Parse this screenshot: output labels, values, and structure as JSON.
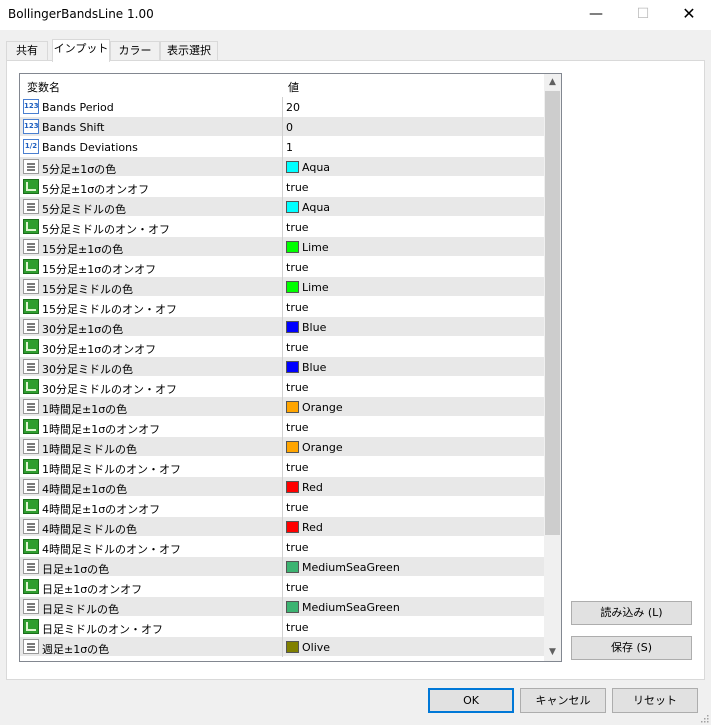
{
  "window": {
    "title": "BollingerBandsLine 1.00"
  },
  "window_controls": {
    "minimize": "—",
    "maximize": "☐",
    "close": "✕"
  },
  "tabs": [
    {
      "label": "共有",
      "active": false
    },
    {
      "label": "インプット",
      "active": true
    },
    {
      "label": "カラー",
      "active": false
    },
    {
      "label": "表示選択",
      "active": false
    }
  ],
  "grid": {
    "header": {
      "name": "変数名",
      "value": "値"
    },
    "rows": [
      {
        "icon": "number-icon",
        "icon_text": "123",
        "name": "Bands Period",
        "value": "20"
      },
      {
        "icon": "number-icon",
        "icon_text": "123",
        "name": "Bands Shift",
        "value": "0"
      },
      {
        "icon": "fraction-icon",
        "icon_text": "1/2",
        "name": "Bands Deviations",
        "value": "1"
      },
      {
        "icon": "color-icon",
        "name": "5分足±1σの色",
        "value": "Aqua",
        "swatch": "#00ffff"
      },
      {
        "icon": "bool-icon",
        "name": "5分足±1σのオンオフ",
        "value": "true"
      },
      {
        "icon": "color-icon",
        "name": "5分足ミドルの色",
        "value": "Aqua",
        "swatch": "#00ffff"
      },
      {
        "icon": "bool-icon",
        "name": "5分足ミドルのオン・オフ",
        "value": "true"
      },
      {
        "icon": "color-icon",
        "name": "15分足±1σの色",
        "value": "Lime",
        "swatch": "#00ff00"
      },
      {
        "icon": "bool-icon",
        "name": "15分足±1σのオンオフ",
        "value": "true"
      },
      {
        "icon": "color-icon",
        "name": "15分足ミドルの色",
        "value": "Lime",
        "swatch": "#00ff00"
      },
      {
        "icon": "bool-icon",
        "name": "15分足ミドルのオン・オフ",
        "value": "true"
      },
      {
        "icon": "color-icon",
        "name": "30分足±1σの色",
        "value": "Blue",
        "swatch": "#0000ff"
      },
      {
        "icon": "bool-icon",
        "name": "30分足±1σのオンオフ",
        "value": "true"
      },
      {
        "icon": "color-icon",
        "name": "30分足ミドルの色",
        "value": "Blue",
        "swatch": "#0000ff"
      },
      {
        "icon": "bool-icon",
        "name": "30分足ミドルのオン・オフ",
        "value": "true"
      },
      {
        "icon": "color-icon",
        "name": "1時間足±1σの色",
        "value": "Orange",
        "swatch": "#ffa500"
      },
      {
        "icon": "bool-icon",
        "name": "1時間足±1σのオンオフ",
        "value": "true"
      },
      {
        "icon": "color-icon",
        "name": "1時間足ミドルの色",
        "value": "Orange",
        "swatch": "#ffa500"
      },
      {
        "icon": "bool-icon",
        "name": "1時間足ミドルのオン・オフ",
        "value": "true"
      },
      {
        "icon": "color-icon",
        "name": "4時間足±1σの色",
        "value": "Red",
        "swatch": "#ff0000"
      },
      {
        "icon": "bool-icon",
        "name": "4時間足±1σのオンオフ",
        "value": "true"
      },
      {
        "icon": "color-icon",
        "name": "4時間足ミドルの色",
        "value": "Red",
        "swatch": "#ff0000"
      },
      {
        "icon": "bool-icon",
        "name": "4時間足ミドルのオン・オフ",
        "value": "true"
      },
      {
        "icon": "color-icon",
        "name": "日足±1σの色",
        "value": "MediumSeaGreen",
        "swatch": "#3cb371"
      },
      {
        "icon": "bool-icon",
        "name": "日足±1σのオンオフ",
        "value": "true"
      },
      {
        "icon": "color-icon",
        "name": "日足ミドルの色",
        "value": "MediumSeaGreen",
        "swatch": "#3cb371"
      },
      {
        "icon": "bool-icon",
        "name": "日足ミドルのオン・オフ",
        "value": "true"
      },
      {
        "icon": "color-icon",
        "name": "週足±1σの色",
        "value": "Olive",
        "swatch": "#808000"
      }
    ]
  },
  "side_buttons": {
    "load": "読み込み (L)",
    "save": "保存 (S)"
  },
  "bottom_buttons": {
    "ok": "OK",
    "cancel": "キャンセル",
    "reset": "リセット"
  },
  "scrollbar": {
    "up_arrow": "▲",
    "down_arrow": "▼"
  }
}
